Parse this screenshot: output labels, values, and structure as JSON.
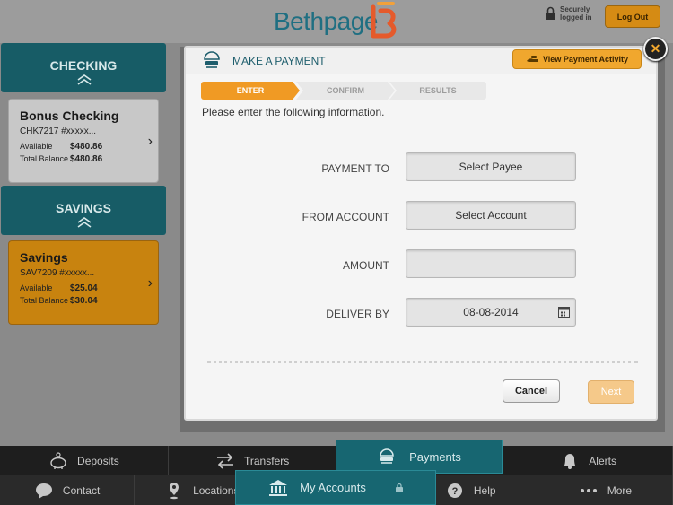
{
  "header": {
    "logo_text": "Bethpage",
    "secure_line1": "Securely",
    "secure_line2": "logged in",
    "logout_label": "Log Out"
  },
  "accounts": {
    "checking_header": "CHECKING",
    "savings_header": "SAVINGS",
    "checking_card": {
      "name": "Bonus Checking",
      "number": "CHK7217 #xxxxx...",
      "available_label": "Available",
      "available_value": "$480.86",
      "total_label": "Total Balance",
      "total_value": "$480.86"
    },
    "savings_card": {
      "name": "Savings",
      "number": "SAV7209 #xxxxx...",
      "available_label": "Available",
      "available_value": "$25.04",
      "total_label": "Total Balance",
      "total_value": "$30.04"
    }
  },
  "modal": {
    "title": "MAKE A PAYMENT",
    "activity_button": "View Payment Activity",
    "steps": [
      "ENTER",
      "CONFIRM",
      "RESULTS"
    ],
    "instructions": "Please enter the following information.",
    "fields": {
      "payment_to_label": "PAYMENT TO",
      "payment_to_value": "Select Payee",
      "from_account_label": "FROM ACCOUNT",
      "from_account_value": "Select Account",
      "amount_label": "AMOUNT",
      "amount_value": "",
      "deliver_by_label": "DELIVER BY",
      "deliver_by_value": "08-08-2014"
    },
    "cancel_label": "Cancel",
    "next_label": "Next"
  },
  "nav": {
    "top": [
      "Deposits",
      "Transfers",
      "Payments",
      "Alerts"
    ],
    "bottom": [
      "Contact",
      "Locations",
      "My Accounts",
      "Help",
      "More"
    ]
  },
  "colors": {
    "teal": "#176671",
    "orange": "#f09a24",
    "logo_blue": "#1f6f82"
  }
}
